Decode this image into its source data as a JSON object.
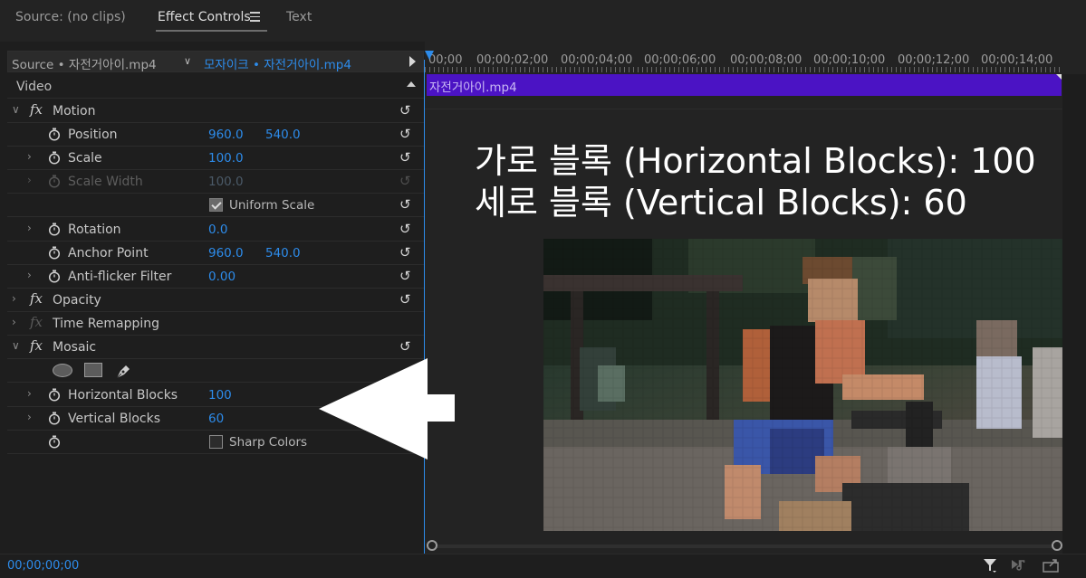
{
  "tabs": {
    "source": "Source: (no clips)",
    "effect_controls": "Effect Controls",
    "text": "Text"
  },
  "source_bar": {
    "source_label": "Source • 자전거아이.mp4",
    "clip_label": "모자이크 • 자전거아이.mp4"
  },
  "timeline": {
    "ruler": [
      "00;00",
      "00;00;02;00",
      "00;00;04;00",
      "00;00;06;00",
      "00;00;08;00",
      "00;00;10;00",
      "00;00;12;00",
      "00;00;14;00"
    ],
    "clip_name": "자전거아이.mp4"
  },
  "sections": {
    "video": "Video",
    "motion": "Motion",
    "opacity": "Opacity",
    "time_remapping": "Time Remapping",
    "mosaic": "Mosaic"
  },
  "motion": {
    "position_label": "Position",
    "position_x": "960.0",
    "position_y": "540.0",
    "scale_label": "Scale",
    "scale_value": "100.0",
    "scale_width_label": "Scale Width",
    "scale_width_value": "100.0",
    "uniform_scale_label": "Uniform Scale",
    "rotation_label": "Rotation",
    "rotation_value": "0.0",
    "anchor_label": "Anchor Point",
    "anchor_x": "960.0",
    "anchor_y": "540.0",
    "antiflicker_label": "Anti-flicker Filter",
    "antiflicker_value": "0.00"
  },
  "mosaic": {
    "horizontal_label": "Horizontal Blocks",
    "horizontal_value": "100",
    "vertical_label": "Vertical Blocks",
    "vertical_value": "60",
    "sharp_colors_label": "Sharp Colors"
  },
  "overlay": {
    "line1": "가로 블록 (Horizontal Blocks): 100",
    "line2": "세로 블록 (Vertical Blocks): 60"
  },
  "timecode": "00;00;00;00",
  "colors": {
    "accent_blue": "#2d8ceb",
    "clip_purple": "#4b13c4",
    "panel_bg": "#1e1e1e"
  }
}
